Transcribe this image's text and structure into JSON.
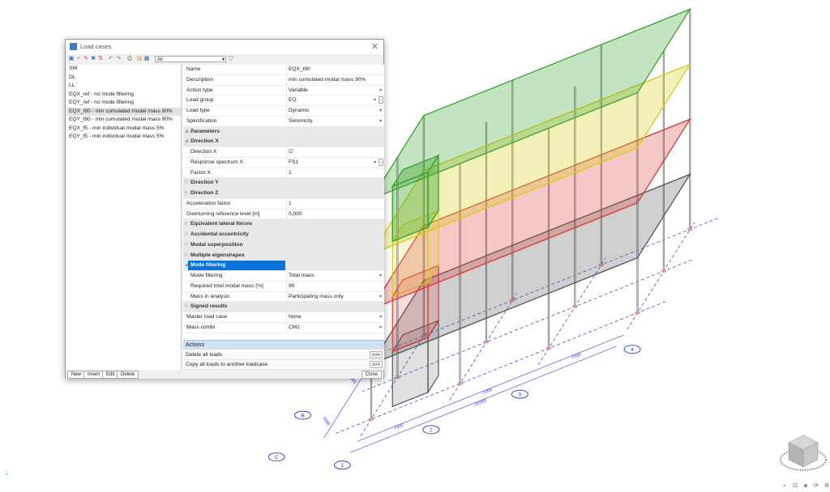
{
  "window": {
    "title": "Load cases",
    "close_glyph": "✕"
  },
  "toolbar": {
    "icons": [
      "new-icon",
      "insert-icon",
      "edit-icon",
      "delete-icon",
      "sort-icon",
      "undo-icon",
      "redo-icon",
      "print-icon",
      "open-icon",
      "save-icon"
    ],
    "filter_value": "All"
  },
  "load_cases": [
    "SW",
    "DL",
    "LL",
    "EQX_ref - no mode filtering",
    "EQY_ref - no mode filtering",
    "EQX_t90 - min cumulated modal mass 90%",
    "EQY_t90 - min cumulated modal mass 90%",
    "EQX_f5 - min individual modal mass 5%",
    "EQY_f5 - min individual modal mass 5%"
  ],
  "selected_index": 5,
  "properties": [
    {
      "kind": "top",
      "label": "Name",
      "value": "EQX_t90"
    },
    {
      "kind": "top",
      "label": "Description",
      "value": "min cumulated modal mass 90%"
    },
    {
      "kind": "top",
      "label": "Action type",
      "value": "Variable",
      "dropdown": true
    },
    {
      "kind": "top",
      "label": "Load group",
      "value": "EQ",
      "dropdown": true,
      "more": true
    },
    {
      "kind": "top",
      "label": "Load type",
      "value": "Dynamic",
      "dropdown": true
    },
    {
      "kind": "top",
      "label": "Specification",
      "value": "Seismicity",
      "dropdown": true
    },
    {
      "kind": "grp",
      "label": "Parameters",
      "expanded": true
    },
    {
      "kind": "grp",
      "label": "Direction X",
      "expanded": true
    },
    {
      "kind": "sub",
      "label": "Direction X",
      "value": "☑"
    },
    {
      "kind": "sub",
      "label": "Response spectrum X",
      "value": "FS1",
      "dropdown": true,
      "more": true
    },
    {
      "kind": "sub",
      "label": "Factor X",
      "value": "1"
    },
    {
      "kind": "grp",
      "label": "Direction Y",
      "expanded": false
    },
    {
      "kind": "grp",
      "label": "Direction Z",
      "expanded": false
    },
    {
      "kind": "top",
      "label": "Acceleration factor",
      "value": "1"
    },
    {
      "kind": "top",
      "label": "Overturning reference level [m]",
      "value": "0,000"
    },
    {
      "kind": "grp",
      "label": "Equivalent lateral forces",
      "expanded": false
    },
    {
      "kind": "grp",
      "label": "Accidental eccentricity",
      "expanded": false
    },
    {
      "kind": "grp",
      "label": "Modal superposition",
      "expanded": false
    },
    {
      "kind": "grp",
      "label": "Multiple eigenshapes",
      "expanded": false
    },
    {
      "kind": "grp",
      "label": "Mode filtering",
      "expanded": true,
      "active": true
    },
    {
      "kind": "sub",
      "label": "Mode filtering",
      "value": "Total mass",
      "dropdown": true
    },
    {
      "kind": "sub",
      "label": "Required total modal mass [%]",
      "value": "90"
    },
    {
      "kind": "sub",
      "label": "Mass in analysis",
      "value": "Participating mass only",
      "dropdown": true
    },
    {
      "kind": "grp",
      "label": "Signed results",
      "expanded": false
    },
    {
      "kind": "top",
      "label": "Master load case",
      "value": "None",
      "dropdown": true
    },
    {
      "kind": "top",
      "label": "Mass combi",
      "value": "CM1",
      "dropdown": true
    }
  ],
  "actions": {
    "header": "Actions",
    "items": [
      {
        "label": "Delete all loads",
        "button": ">>>"
      },
      {
        "label": "Copy all loads to another loadcase",
        "button": ">>>"
      }
    ]
  },
  "bottom_buttons": [
    "New",
    "Insert",
    "Edit",
    "Delete"
  ],
  "close_label": "Close",
  "grid": {
    "axis_numbers": [
      "1",
      "2",
      "3",
      "4"
    ],
    "axis_letters": [
      "B",
      "C"
    ],
    "dims_x": [
      "7000",
      "7000",
      "7000"
    ],
    "total_x": "21000",
    "dims_y": [
      "7000",
      "7000"
    ]
  },
  "colors": {
    "green": "#3aa32f",
    "yellow": "#d6cc16",
    "red": "#d63a35",
    "grey": "#555555",
    "selection": "#0a74d8",
    "axis": "#2b34c8"
  }
}
